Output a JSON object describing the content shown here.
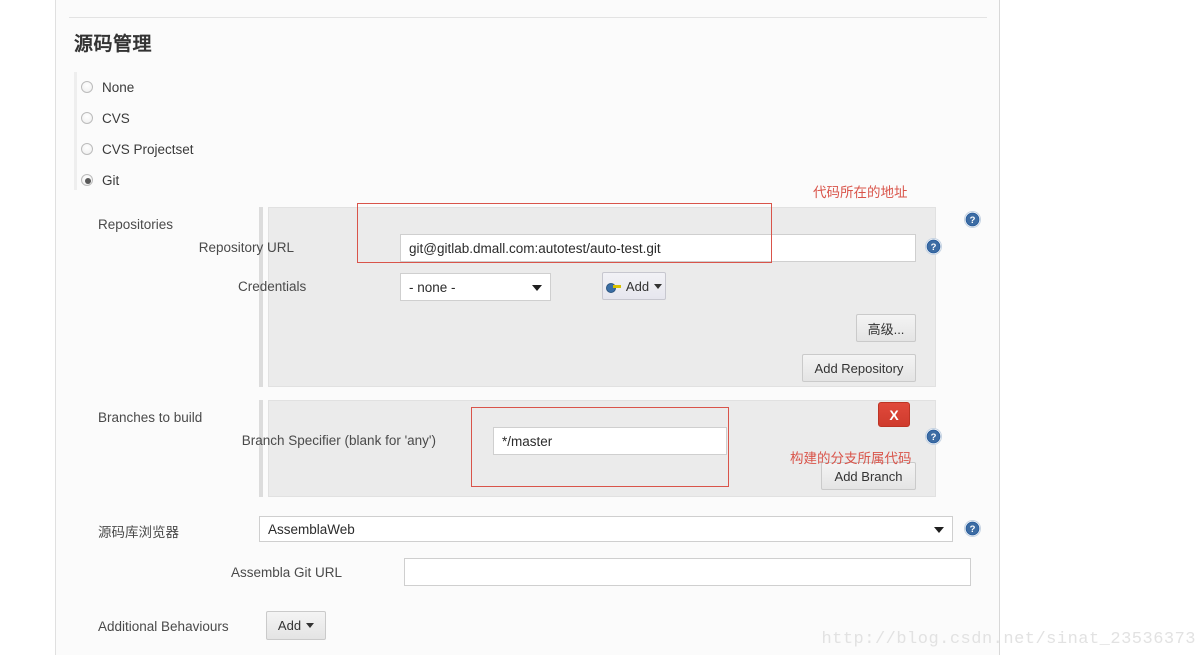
{
  "page": {
    "section_title": "源码管理",
    "watermark": "http://blog.csdn.net/sinat_23536373"
  },
  "scm_options": [
    {
      "label": "None",
      "checked": false
    },
    {
      "label": "CVS",
      "checked": false
    },
    {
      "label": "CVS Projectset",
      "checked": false
    },
    {
      "label": "Git",
      "checked": true
    }
  ],
  "repositories": {
    "gutter_label": "Repositories",
    "repository_url": {
      "label": "Repository URL",
      "value": "git@gitlab.dmall.com:autotest/auto-test.git"
    },
    "credentials": {
      "label": "Credentials",
      "selected": "- none -",
      "add_button": "Add",
      "add_icon": "key-icon"
    },
    "advanced_button": "高级...",
    "add_repository_button": "Add Repository"
  },
  "branches": {
    "gutter_label": "Branches to build",
    "branch_specifier": {
      "label": "Branch Specifier (blank for 'any')",
      "value": "*/master"
    },
    "delete_button": "X",
    "add_branch_button": "Add Branch"
  },
  "browser": {
    "gutter_label": "源码库浏览器",
    "selected": "AssemblaWeb",
    "assembla_git_url": {
      "label": "Assembla Git URL",
      "value": ""
    }
  },
  "additional_behaviours": {
    "gutter_label": "Additional Behaviours",
    "add_button": "Add"
  },
  "annotations": [
    {
      "text": "代码所在的地址"
    },
    {
      "text": "构建的分支所属代码"
    }
  ],
  "colors": {
    "annotation_red": "#d9544a",
    "danger_red": "#cf3b2d",
    "help_blue": "#2b5f9e",
    "panel_bg": "#fbfbfb",
    "nested_bg": "#ebebeb"
  },
  "icons": {
    "help": "question-circle-icon"
  }
}
